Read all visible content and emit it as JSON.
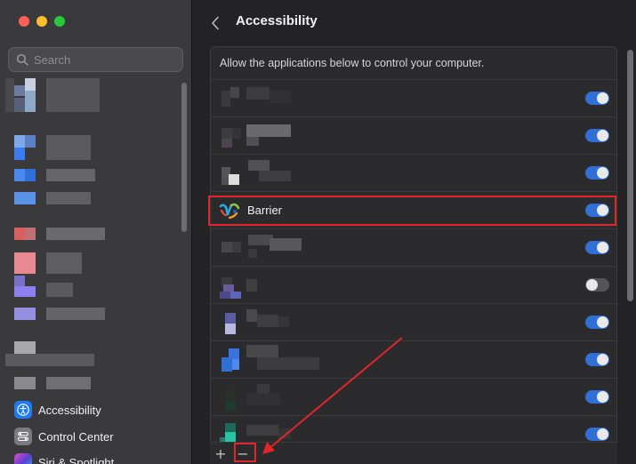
{
  "sidebar": {
    "search": {
      "placeholder": "Search"
    },
    "items": [
      {
        "label": "Accessibility",
        "icon": "accessibility-icon",
        "color": "#1e7bf1"
      },
      {
        "label": "Control Center",
        "icon": "control-center-icon",
        "color": "#7a7a7e"
      },
      {
        "label": "Siri & Spotlight",
        "icon": "siri-icon",
        "color": "#5b3fd1"
      }
    ]
  },
  "header": {
    "title": "Accessibility",
    "back_icon": "chevron-left-icon"
  },
  "panel": {
    "description": "Allow the applications below to control your computer.",
    "apps": [
      {
        "label": "",
        "enabled": true
      },
      {
        "label": "",
        "enabled": true
      },
      {
        "label": "",
        "enabled": true
      },
      {
        "label": "Barrier",
        "enabled": true,
        "icon": "barrier-app-icon"
      },
      {
        "label": "",
        "enabled": true
      },
      {
        "label": "",
        "enabled": false
      },
      {
        "label": "",
        "enabled": true
      },
      {
        "label": "",
        "enabled": true
      },
      {
        "label": "",
        "enabled": true
      },
      {
        "label": "",
        "enabled": true
      }
    ]
  },
  "footer": {
    "add_label": "+",
    "remove_label": "−"
  },
  "colors": {
    "accent": "#2f6fd6",
    "annotation": "#e0262b"
  }
}
